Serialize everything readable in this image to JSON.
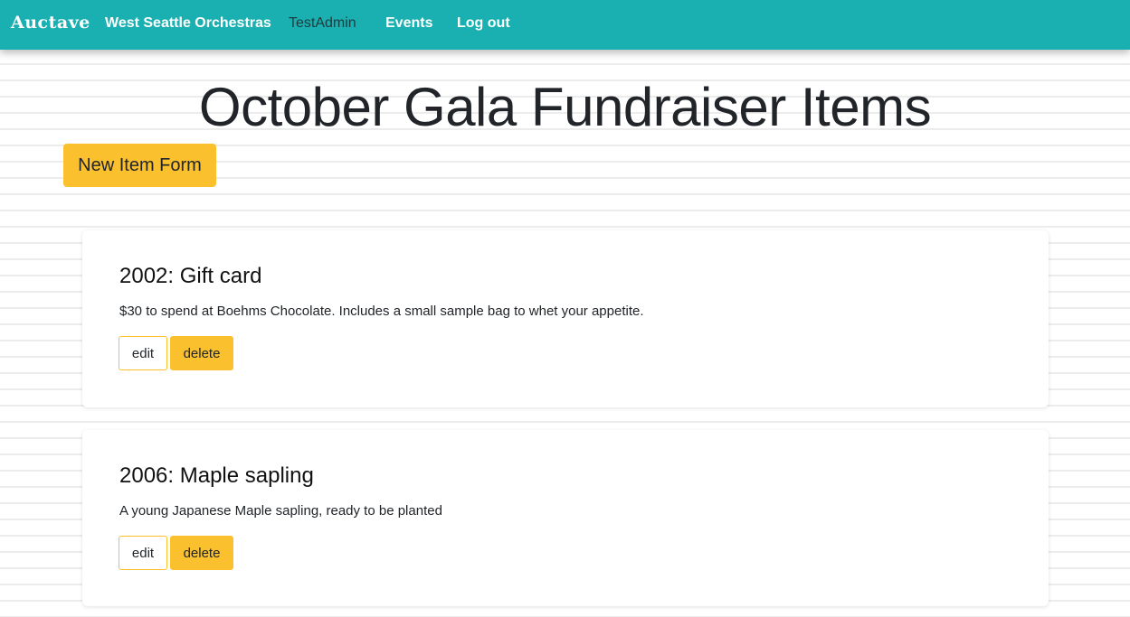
{
  "nav": {
    "brand": "Auctave",
    "org": "West Seattle Orchestras",
    "user": "TestAdmin",
    "events": "Events",
    "logout": "Log out"
  },
  "page": {
    "title": "October Gala Fundraiser Items",
    "new_item_label": "New Item Form"
  },
  "items": [
    {
      "title": "2002: Gift card",
      "description": "$30 to spend at Boehms Chocolate. Includes a small sample bag to whet your appetite.",
      "edit_label": "edit",
      "delete_label": "delete"
    },
    {
      "title": "2006: Maple sapling",
      "description": "A young Japanese Maple sapling, ready to be planted",
      "edit_label": "edit",
      "delete_label": "delete"
    }
  ],
  "colors": {
    "navbar": "#1aafb1",
    "accent": "#fbc02d"
  }
}
